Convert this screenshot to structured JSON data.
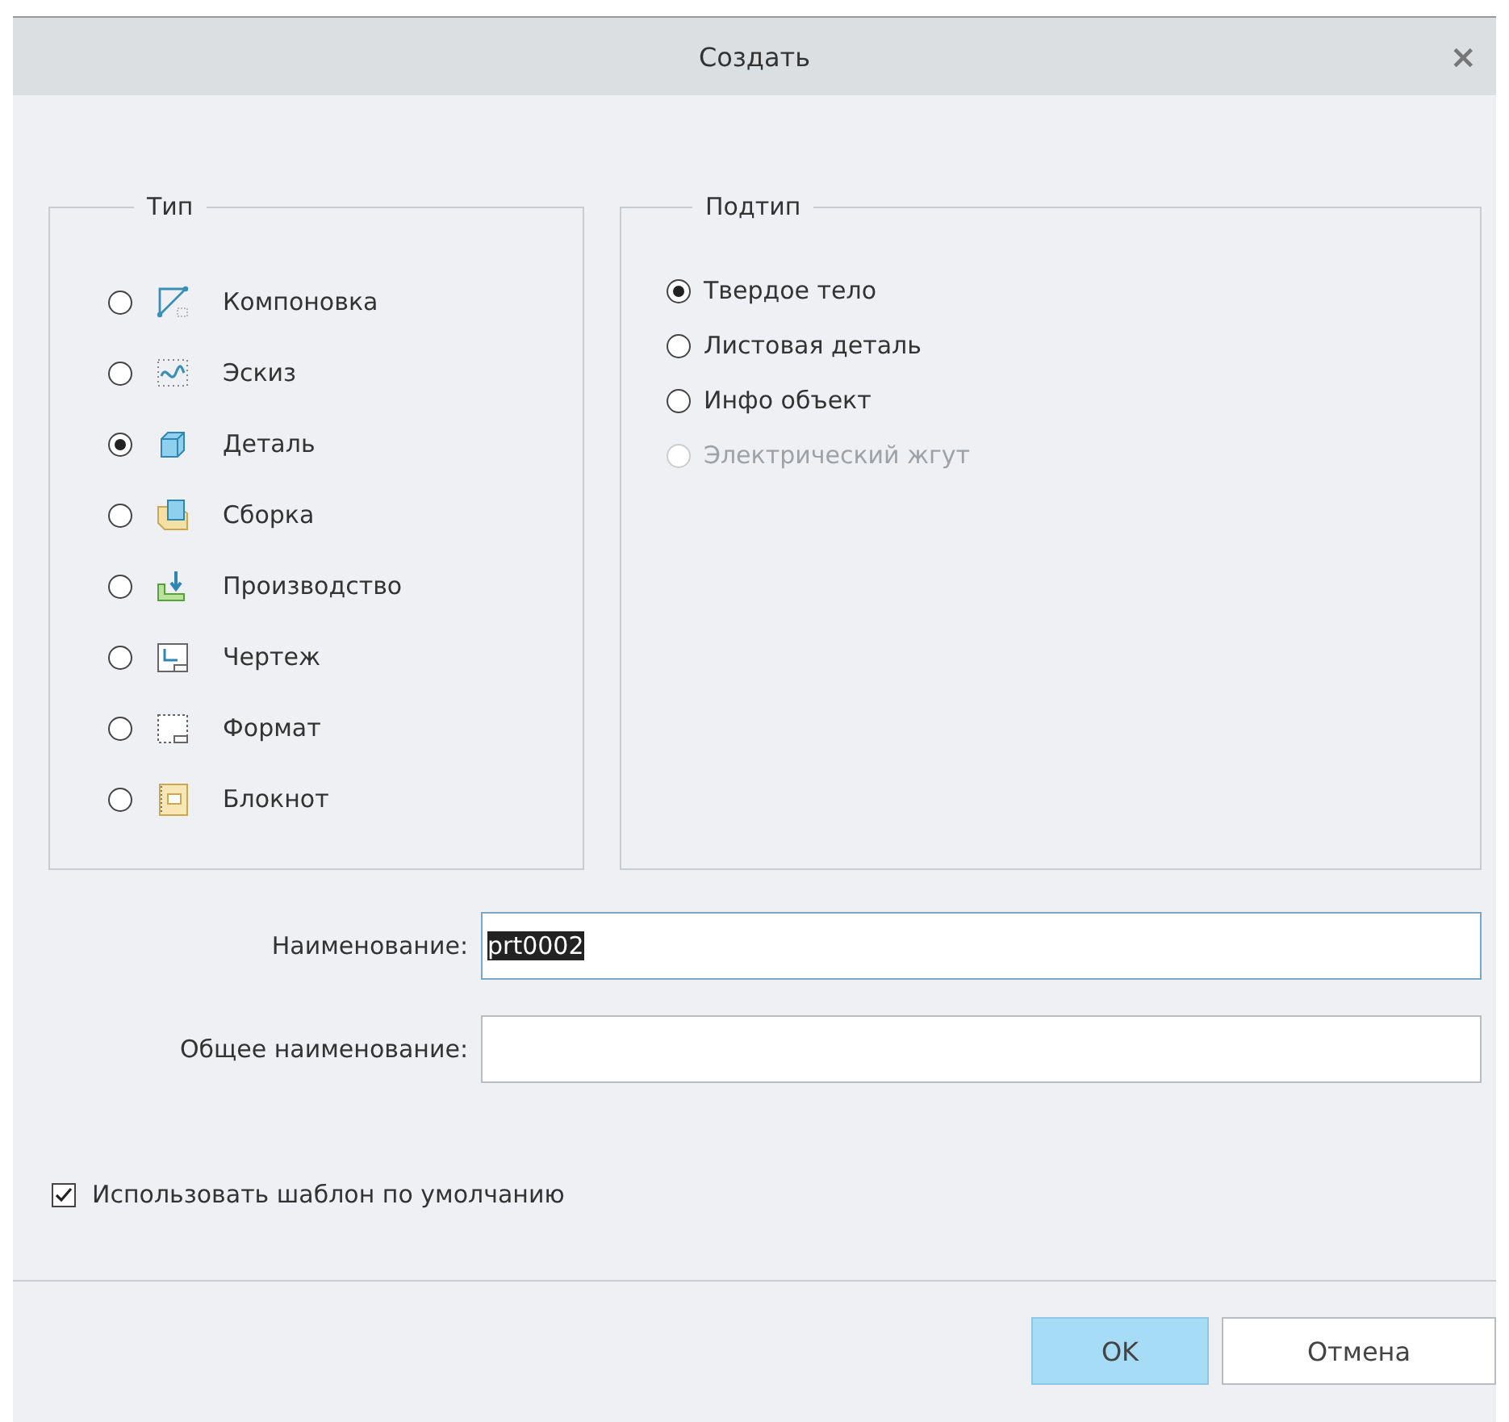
{
  "window": {
    "title": "Создать",
    "close": "×"
  },
  "type_group": {
    "title": "Тип",
    "items": [
      {
        "label": "Компоновка",
        "kind": "layout",
        "selected": false
      },
      {
        "label": "Эскиз",
        "kind": "sketch",
        "selected": false
      },
      {
        "label": "Деталь",
        "kind": "part",
        "selected": true
      },
      {
        "label": "Сборка",
        "kind": "assembly",
        "selected": false
      },
      {
        "label": "Производство",
        "kind": "manufacturing",
        "selected": false
      },
      {
        "label": "Чертеж",
        "kind": "drawing",
        "selected": false
      },
      {
        "label": "Формат",
        "kind": "format",
        "selected": false
      },
      {
        "label": "Блокнот",
        "kind": "notebook",
        "selected": false
      }
    ]
  },
  "subtype_group": {
    "title": "Подтип",
    "items": [
      {
        "label": "Твердое тело",
        "selected": true,
        "disabled": false
      },
      {
        "label": "Листовая деталь",
        "selected": false,
        "disabled": false
      },
      {
        "label": "Инфо объект",
        "selected": false,
        "disabled": false
      },
      {
        "label": "Электрический жгут",
        "selected": false,
        "disabled": true
      }
    ]
  },
  "fields": [
    {
      "label": "Наименование:",
      "value": "prt0002",
      "selected": true
    },
    {
      "label": "Общее наименование:",
      "selected": false
    }
  ],
  "use_default_template": {
    "label": "Использовать шаблон по умолчанию",
    "checked": true
  },
  "buttons": [
    {
      "label": "OK",
      "primary": true
    },
    {
      "label": "Отмена",
      "primary": false
    }
  ]
}
